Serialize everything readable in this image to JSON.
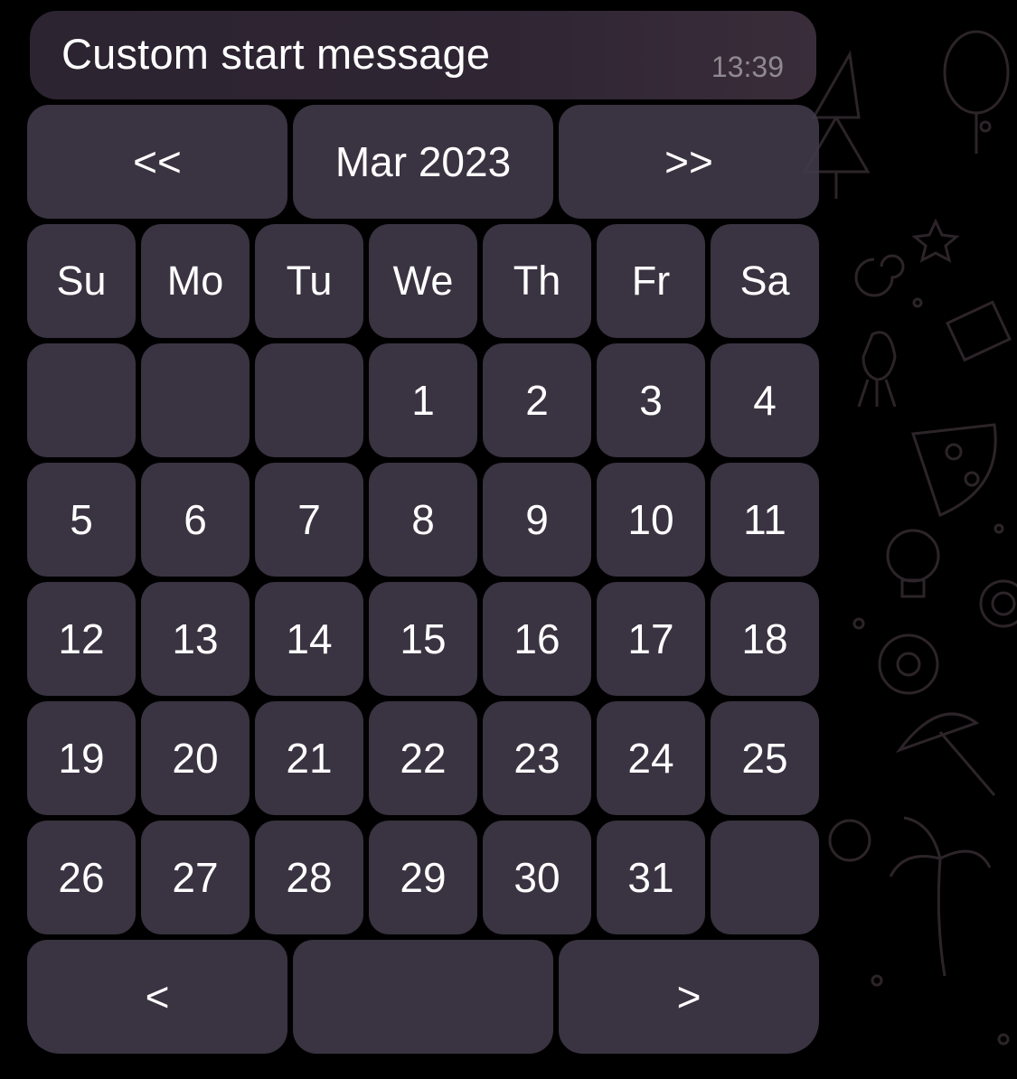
{
  "message": {
    "text": "Custom start message",
    "time": "13:39"
  },
  "calendar": {
    "nav": {
      "prev_label": "<<",
      "month_label": "Mar 2023",
      "next_label": ">>"
    },
    "weekdays": [
      "Su",
      "Mo",
      "Tu",
      "We",
      "Th",
      "Fr",
      "Sa"
    ],
    "weeks": [
      [
        "",
        "",
        "",
        "1",
        "2",
        "3",
        "4"
      ],
      [
        "5",
        "6",
        "7",
        "8",
        "9",
        "10",
        "11"
      ],
      [
        "12",
        "13",
        "14",
        "15",
        "16",
        "17",
        "18"
      ],
      [
        "19",
        "20",
        "21",
        "22",
        "23",
        "24",
        "25"
      ],
      [
        "26",
        "27",
        "28",
        "29",
        "30",
        "31",
        ""
      ]
    ],
    "footer": {
      "prev_label": "<",
      "middle_label": "",
      "next_label": ">"
    }
  },
  "colors": {
    "background": "#000000",
    "button": "#423a4a",
    "bubble": "#2f2533",
    "timestamp": "#8f8991"
  }
}
